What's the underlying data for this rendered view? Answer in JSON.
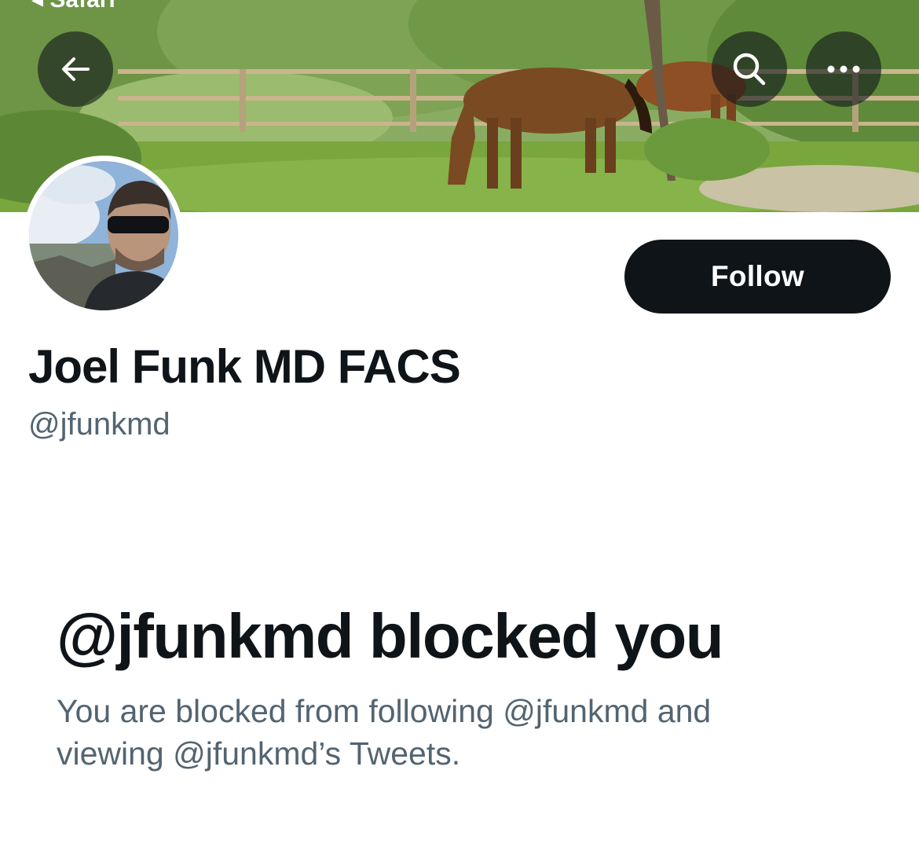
{
  "status_bar": {
    "fragment": "◂ Safari"
  },
  "header": {
    "back_icon": "arrow-left-icon",
    "search_icon": "search-icon",
    "more_icon": "more-horizontal-icon"
  },
  "profile": {
    "display_name": "Joel Funk MD FACS",
    "handle": "@jfunkmd",
    "follow_label": "Follow"
  },
  "blocked": {
    "title": "@jfunkmd blocked you",
    "description_line1": "You are blocked from following @jfunkmd and",
    "description_line2": "viewing @jfunkmd’s Tweets."
  },
  "colors": {
    "text_primary": "#0f1419",
    "text_secondary": "#536471",
    "button_bg": "#0f1419",
    "overlay_button_bg": "rgba(15,20,25,0.6)"
  }
}
